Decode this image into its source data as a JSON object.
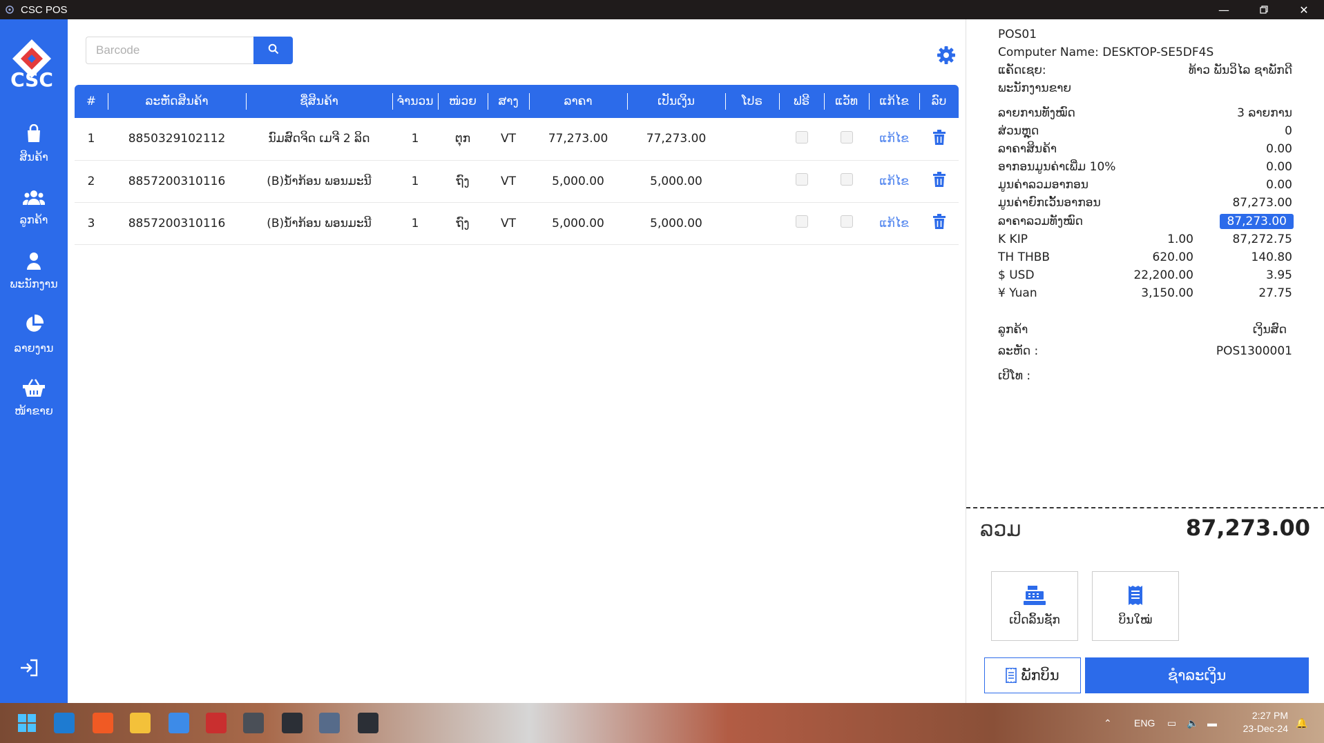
{
  "window": {
    "title": "CSC POS"
  },
  "sidebar": {
    "logo_text": "CSC",
    "items": [
      {
        "label": "ສິນຄ້າ",
        "icon": "shopping-bag-icon"
      },
      {
        "label": "ລູກຄ້າ",
        "icon": "users-icon"
      },
      {
        "label": "ພະນັກງານ",
        "icon": "user-icon"
      },
      {
        "label": "ລາຍງານ",
        "icon": "pie-chart-icon"
      },
      {
        "label": "ໜ້າຂາຍ",
        "icon": "basket-icon"
      }
    ]
  },
  "search": {
    "placeholder": "Barcode",
    "value": ""
  },
  "table": {
    "headers": [
      "#",
      "ລະຫັດສິນຄ້າ",
      "ຊື່ສິນຄ້າ",
      "ຈຳນວນ",
      "ໜ່ວຍ",
      "ສາງ",
      "ລາຄາ",
      "ເປັນເງິນ",
      "ໂປຣ",
      "ຟຣີ",
      "ແວັທ",
      "ແກ້ໄຂ",
      "ລົບ"
    ],
    "rows": [
      {
        "no": "1",
        "code": "8850329102112",
        "name": "ນົມສົດຈິດ ເມຈີ 2 ລິດ",
        "qty": "1",
        "unit": "ຕຸກ",
        "warehouse": "VT",
        "price": "77,273.00",
        "amount": "77,273.00",
        "promo": "",
        "edit": "ແກ້ໄຂ"
      },
      {
        "no": "2",
        "code": "8857200310116",
        "name": "(B)ນ້ຳກ້ອນ ພອນມະນີ",
        "qty": "1",
        "unit": "ຖົງ",
        "warehouse": "VT",
        "price": "5,000.00",
        "amount": "5,000.00",
        "promo": "",
        "edit": "ແກ້ໄຂ"
      },
      {
        "no": "3",
        "code": "8857200310116",
        "name": "(B)ນ້ຳກ້ອນ ພອນມະນີ",
        "qty": "1",
        "unit": "ຖົງ",
        "warehouse": "VT",
        "price": "5,000.00",
        "amount": "5,000.00",
        "promo": "",
        "edit": "ແກ້ໄຂ"
      }
    ]
  },
  "panel": {
    "pos_id": "POS01",
    "computer_name": "Computer Name: DESKTOP-SE5DF4S",
    "cashier_label": "ແຄັດເຊຍ:",
    "cashier_value": "ທ້າວ ພັນວິໄລ ຊາພັກດີ",
    "staff_label": "ພະນັກງານຂາຍ",
    "summary": [
      {
        "label": "ລາຍການທັງໝົດ",
        "value": "3 ລາຍການ"
      },
      {
        "label": "ສ່ວນຫຼຸດ",
        "value": "0"
      },
      {
        "label": "ລາຄາສິນຄ້າ",
        "value": "0.00"
      },
      {
        "label": "ອາກອນມູນຄ່າເພີ່ມ 10%",
        "value": "0.00"
      },
      {
        "label": "ມູນຄ່າລວມອາກອນ",
        "value": "0.00"
      },
      {
        "label": "ມູນຄ່າຍົກເວັ້ນອາກອນ",
        "value": "87,273.00"
      },
      {
        "label": "ລາຄາລວມທັງໝົດ",
        "value": "87,273.00"
      }
    ],
    "currencies": [
      {
        "name": "K KIP",
        "rate": "1.00",
        "amount": "87,272.75"
      },
      {
        "name": "TH THBB",
        "rate": "620.00",
        "amount": "140.80"
      },
      {
        "name": "$ USD",
        "rate": "22,200.00",
        "amount": "3.95"
      },
      {
        "name": "¥ Yuan",
        "rate": "3,150.00",
        "amount": "27.75"
      }
    ],
    "customer_label": "ລູກຄ້າ",
    "customer_value": "ເງິນສົດ",
    "code_label": "ລະຫັດ :",
    "code_value": "POS1300001",
    "phone_label": "ເບີໂທ :",
    "total_label": "ລວມ",
    "total_value": "87,273.00",
    "open_drawer": "ເປີດລິ້ນຊັກ",
    "new_bill": "ບິນໃໝ່",
    "hold_bill": "ພັກບິນ",
    "pay": "ຊຳລະເງິນ"
  },
  "taskbar": {
    "language": "ENG",
    "time": "2:27 PM",
    "date": "23-Dec-24"
  },
  "colors": {
    "accent": "#2c6bea",
    "titlebar": "#1f1b1b"
  }
}
